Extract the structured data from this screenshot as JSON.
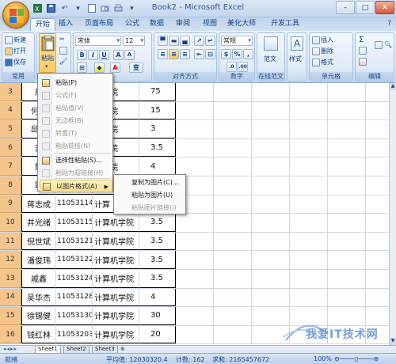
{
  "window": {
    "title": "Book2 - Microsoft Excel",
    "controls": [
      "–",
      "□",
      "✕"
    ]
  },
  "tabs": [
    "开始",
    "插入",
    "页面布局",
    "公式",
    "数据",
    "审阅",
    "视图",
    "美化大师",
    "开发工具"
  ],
  "ribbon": {
    "file": {
      "new": "新建",
      "open": "打开",
      "save": "保存",
      "label": "常用"
    },
    "clipboard": {
      "paste": "粘贴"
    },
    "font": {
      "name": "宋体",
      "size": "12",
      "bold": "B",
      "italic": "I",
      "underline": "U",
      "color_a": "A",
      "wen": "变"
    },
    "alignment": {
      "label": "对齐方式"
    },
    "number": {
      "format": "常规",
      "percent": "%",
      "comma": ",",
      "label": "数字"
    },
    "online": {
      "text": "范文",
      "label": "在线范文"
    },
    "styles": {
      "text": "样式"
    },
    "cells": {
      "insert": "插入",
      "delete": "删除",
      "format": "格式",
      "label": "单元格"
    },
    "editing": {
      "sigma": "Σ",
      "label": "编辑"
    }
  },
  "paste_menu": {
    "items": [
      {
        "label": "粘贴(P)",
        "enabled": true
      },
      {
        "label": "公式(F)",
        "enabled": false
      },
      {
        "label": "粘贴值(V)",
        "enabled": false
      },
      {
        "label": "无边框(B)",
        "enabled": false
      },
      {
        "label": "转置(T)",
        "enabled": false
      },
      {
        "label": "粘贴链接(N)",
        "enabled": false
      },
      {
        "label": "选择性粘贴(S)...",
        "enabled": true
      },
      {
        "label": "粘贴为超链接(H)",
        "enabled": false
      },
      {
        "label": "以图片格式(A)",
        "enabled": true,
        "highlighted": true
      }
    ]
  },
  "sub_menu": {
    "items": [
      {
        "label": "复制为图片(C)...",
        "enabled": true
      },
      {
        "label": "粘贴为图片(U)",
        "enabled": true
      },
      {
        "label": "粘贴图片链接(I)",
        "enabled": false
      }
    ]
  },
  "rows": [
    {
      "num": "3",
      "name": "唐",
      "id": "",
      "college": "机学院",
      "score": "75"
    },
    {
      "num": "4",
      "name": "何玺",
      "id": "",
      "college": "机学院",
      "score": "15"
    },
    {
      "num": "5",
      "name": "邱畅",
      "id": "",
      "college": "机学院",
      "score": "3"
    },
    {
      "num": "6",
      "name": "苏",
      "id": "",
      "college": "机学院",
      "score": "3.5"
    },
    {
      "num": "7",
      "name": "陈",
      "id": "",
      "college": "机学院",
      "score": "4"
    },
    {
      "num": "8",
      "name": "耿",
      "id": "",
      "college": "",
      "score": ""
    },
    {
      "num": "9",
      "name": "蒋志成",
      "id": "11053114",
      "college": "计算",
      "score": ""
    },
    {
      "num": "10",
      "name": "井光绪",
      "id": "11053115",
      "college": "计算机学院",
      "score": "3.5"
    },
    {
      "num": "11",
      "name": "倪世斌",
      "id": "11053121",
      "college": "计算机学院",
      "score": "3.5"
    },
    {
      "num": "12",
      "name": "潘俊玮",
      "id": "11053122",
      "college": "计算机学院",
      "score": "3.5"
    },
    {
      "num": "13",
      "name": "戚鑫",
      "id": "11053124",
      "college": "计算机学院",
      "score": "3.5"
    },
    {
      "num": "14",
      "name": "吴华杰",
      "id": "11053128",
      "college": "计算机学院",
      "score": "4"
    },
    {
      "num": "15",
      "name": "徐锡健",
      "id": "11053130",
      "college": "计算机学院",
      "score": "30"
    },
    {
      "num": "16",
      "name": "钱红林",
      "id": "11053203",
      "college": "计算机学院",
      "score": "20"
    }
  ],
  "sheets": [
    "Sheet1",
    "Sheet2",
    "Sheet3"
  ],
  "status": {
    "ready": "就绪",
    "avg": "平均值: 12030320.4",
    "count": "计数: 162",
    "sum": "求和: 2165457672",
    "zoom": "100%"
  },
  "watermark": {
    "text": "我爱IT技术网"
  },
  "colors": {
    "ribbon_bg": "#dbe7f6",
    "row_header": "#f5c58c",
    "menu_highlight": "#fbe08c",
    "text": "#15428b"
  }
}
